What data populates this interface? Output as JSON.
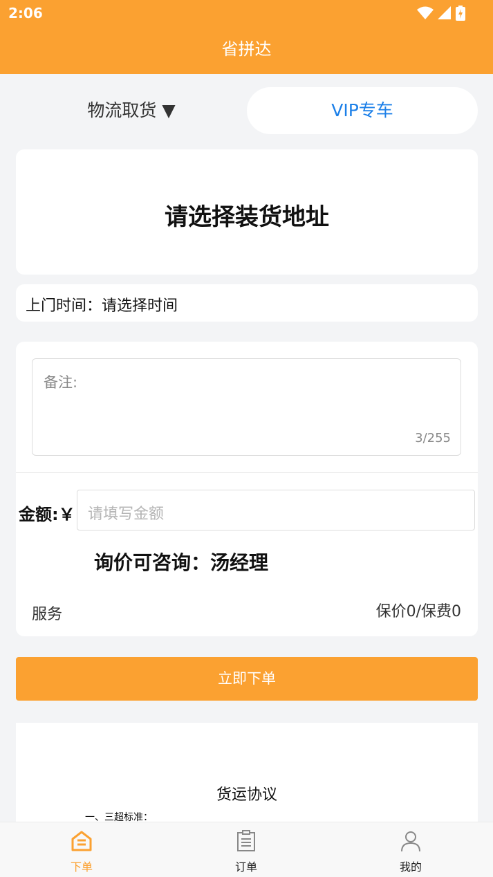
{
  "status_bar": {
    "time": "2:06",
    "icons": [
      "wifi-icon",
      "signal-icon",
      "battery-icon"
    ]
  },
  "header": {
    "title": "省拼达"
  },
  "tabs": {
    "logistics": "物流取货 ▼",
    "vip": "VIP专车"
  },
  "address": {
    "title": "请选择装货地址"
  },
  "pickup_time": {
    "text": "上门时间：请选择时间"
  },
  "remark": {
    "placeholder": "备注:",
    "count": "3/255"
  },
  "amount": {
    "label": "金额:￥",
    "placeholder": "请填写金额"
  },
  "inquiry": {
    "text": "询价可咨询：汤经理"
  },
  "service": {
    "label": "服务",
    "insurance": "保价0/保费0"
  },
  "order_button": {
    "label": "立即下单"
  },
  "agreement": {
    "title": "货运协议",
    "clause": "一、三超标准："
  },
  "bottom_nav": {
    "items": [
      {
        "label": "下单",
        "icon": "home-icon",
        "active": true
      },
      {
        "label": "订单",
        "icon": "clipboard-icon",
        "active": false
      },
      {
        "label": "我的",
        "icon": "user-icon",
        "active": false
      }
    ]
  },
  "colors": {
    "brand": "#fba131",
    "tab_active_text": "#1b7fe8",
    "background": "#f3f4f6"
  }
}
